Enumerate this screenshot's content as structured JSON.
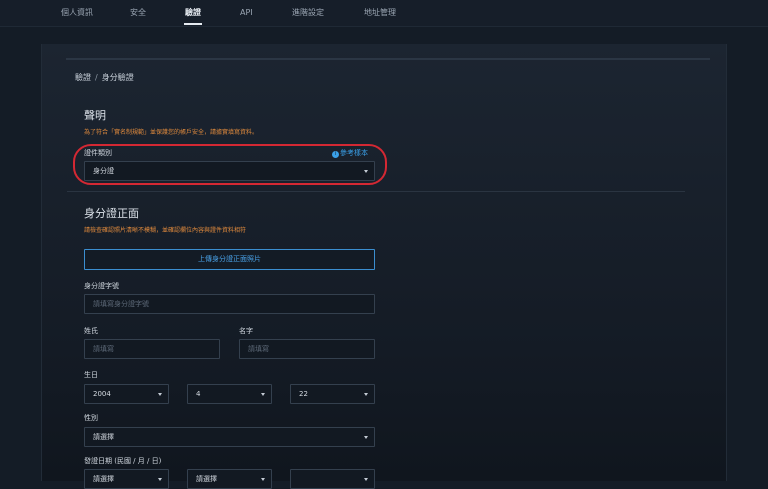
{
  "nav": {
    "tabs": [
      {
        "label": "個人資訊"
      },
      {
        "label": "安全"
      },
      {
        "label": "驗證",
        "active": true
      },
      {
        "label": "API"
      },
      {
        "label": "進階設定"
      },
      {
        "label": "地址管理"
      }
    ]
  },
  "breadcrumb": {
    "root": "驗證",
    "separator": "/",
    "current": "身分驗證"
  },
  "statement": {
    "title": "聲明",
    "description": "為了符合「實名制規範」並保護您的帳戶安全，請據實填寫資料。"
  },
  "doc_type": {
    "label": "證件類別",
    "sample_link": "參考樣本",
    "value": "身分證"
  },
  "id_front": {
    "title": "身分證正面",
    "description": "請檢查確認照片清晰不模糊，並確認欄位內容與證件資料相符",
    "upload_label": "上傳身分證正面照片"
  },
  "id_number": {
    "label": "身分證字號",
    "placeholder": "請填寫身分證字號"
  },
  "surname": {
    "label": "姓氏",
    "placeholder": "請填寫"
  },
  "given_name": {
    "label": "名字",
    "placeholder": "請填寫"
  },
  "birthday": {
    "label": "生日",
    "year": "2004",
    "month": "4",
    "day": "22"
  },
  "gender": {
    "label": "性別",
    "value": "請選擇"
  },
  "issue_date": {
    "label": "發證日期 (民國 / 月 / 日)",
    "year": "請選擇",
    "month": "請選擇",
    "day": ""
  },
  "colors": {
    "accent": "#3aa0e8",
    "warning": "#e08a3d",
    "highlight": "#d42833"
  }
}
